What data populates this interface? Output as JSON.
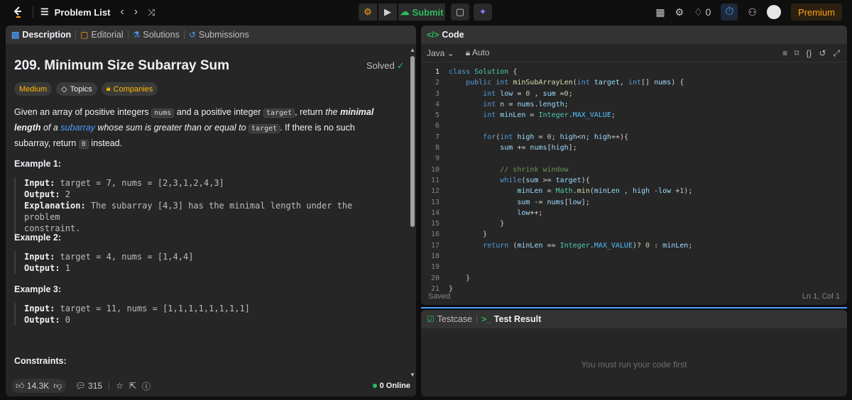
{
  "topbar": {
    "logo": "leetcode-logo",
    "problem_list": "Problem List",
    "submit": "Submit",
    "streak": "0",
    "premium": "Premium"
  },
  "left_tabs": [
    "Description",
    "Editorial",
    "Solutions",
    "Submissions"
  ],
  "problem": {
    "title": "209. Minimum Size Subarray Sum",
    "solved": "Solved",
    "difficulty": "Medium",
    "topics": "Topics",
    "companies": "Companies",
    "statement": {
      "p1": "Given an array of positive integers ",
      "c1": "nums",
      "p2": " and a positive integer ",
      "c2": "target",
      "p3": ", return ",
      "e1": "the ",
      "b1": "minimal length",
      "e2": " of a ",
      "link": "subarray",
      "e3": " whose sum is greater than or equal to ",
      "c3": "target",
      "p4": ". If there is no such subarray, return ",
      "c4": "0",
      "p5": " instead."
    },
    "examples": [
      {
        "head": "Example 1:",
        "input_label": "Input:",
        "input": " target = 7, nums = [2,3,1,2,4,3]",
        "output_label": "Output:",
        "output": " 2",
        "exp_label": "Explanation:",
        "exp": " The subarray [4,3] has the minimal length under the problem",
        "exp2": "constraint."
      },
      {
        "head": "Example 2:",
        "input_label": "Input:",
        "input": " target = 4, nums = [1,4,4]",
        "output_label": "Output:",
        "output": " 1"
      },
      {
        "head": "Example 3:",
        "input_label": "Input:",
        "input": " target = 11, nums = [1,1,1,1,1,1,1,1]",
        "output_label": "Output:",
        "output": " 0"
      }
    ],
    "constraints": "Constraints:"
  },
  "footer": {
    "likes": "14.3K",
    "comments": "315",
    "online": "0 Online"
  },
  "code": {
    "tab": "Code",
    "language": "Java",
    "mode": "Auto",
    "saved": "Saved",
    "cursor": "Ln 1, Col 1"
  },
  "test": {
    "tab1": "Testcase",
    "tab2": "Test Result",
    "hint": "You must run your code first"
  }
}
